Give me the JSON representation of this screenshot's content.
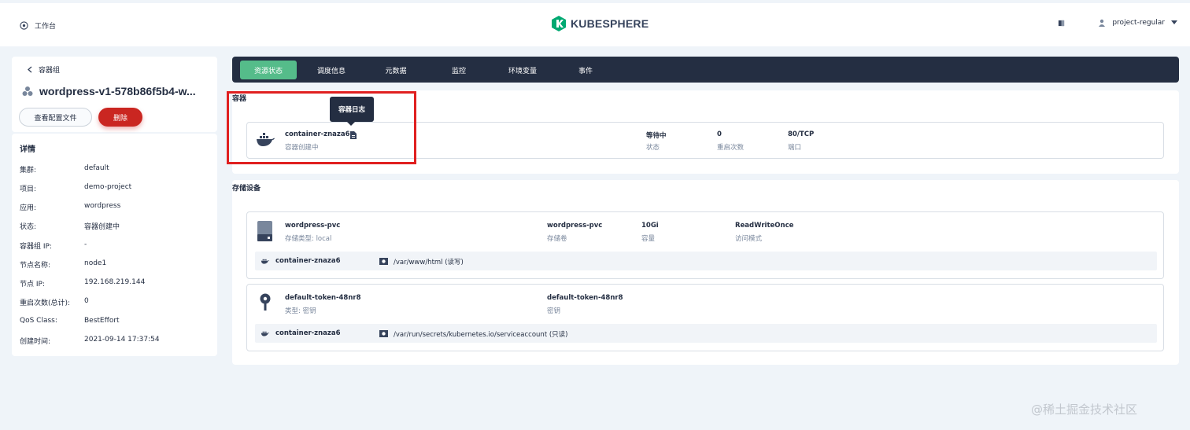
{
  "header": {
    "workbench_label": "工作台",
    "brand": "KUBESPHERE",
    "user": "project-regular",
    "brand_color": "#00a971"
  },
  "pod": {
    "back_label": "容器组",
    "name": "wordpress-v1-578b86f5b4-w...",
    "view_config_label": "查看配置文件",
    "delete_label": "删除"
  },
  "details": {
    "title": "详情",
    "rows": [
      {
        "key": "集群:",
        "value": "default"
      },
      {
        "key": "项目:",
        "value": "demo-project"
      },
      {
        "key": "应用:",
        "value": "wordpress"
      },
      {
        "key": "状态:",
        "value": "容器创建中"
      },
      {
        "key": "容器组 IP:",
        "value": "-"
      },
      {
        "key": "节点名称:",
        "value": "node1"
      },
      {
        "key": "节点 IP:",
        "value": "192.168.219.144"
      },
      {
        "key": "重启次数(总计):",
        "value": "0"
      },
      {
        "key": "QoS Class:",
        "value": "BestEffort"
      },
      {
        "key": "创建时间:",
        "value": "2021-09-14 17:37:54"
      }
    ]
  },
  "tabs": [
    {
      "label": "资源状态",
      "active": true
    },
    {
      "label": "调度信息",
      "active": false
    },
    {
      "label": "元数据",
      "active": false
    },
    {
      "label": "监控",
      "active": false
    },
    {
      "label": "环境变量",
      "active": false
    },
    {
      "label": "事件",
      "active": false
    }
  ],
  "containers": {
    "section_label": "容器",
    "tooltip": "容器日志",
    "item": {
      "name": "container-znaza6",
      "sub": "容器创建中",
      "status_value": "等待中",
      "status_label": "状态",
      "restarts_value": "0",
      "restarts_label": "重启次数",
      "port_value": "80/TCP",
      "port_label": "端口"
    }
  },
  "storage": {
    "section_label": "存储设备",
    "volumes": [
      {
        "name": "wordpress-pvc",
        "sub": "存储类型: local",
        "col1_value": "wordpress-pvc",
        "col1_label": "存储卷",
        "col2_value": "10Gi",
        "col2_label": "容量",
        "col3_value": "ReadWriteOnce",
        "col3_label": "访问模式",
        "mount_container": "container-znaza6",
        "mount_path": "/var/www/html (读写)"
      },
      {
        "name": "default-token-48nr8",
        "sub": "类型: 密钥",
        "col1_value": "default-token-48nr8",
        "col1_label": "密钥",
        "mount_container": "container-znaza6",
        "mount_path": "/var/run/secrets/kubernetes.io/serviceaccount (只读)"
      }
    ]
  },
  "watermark": "@稀土掘金技术社区"
}
